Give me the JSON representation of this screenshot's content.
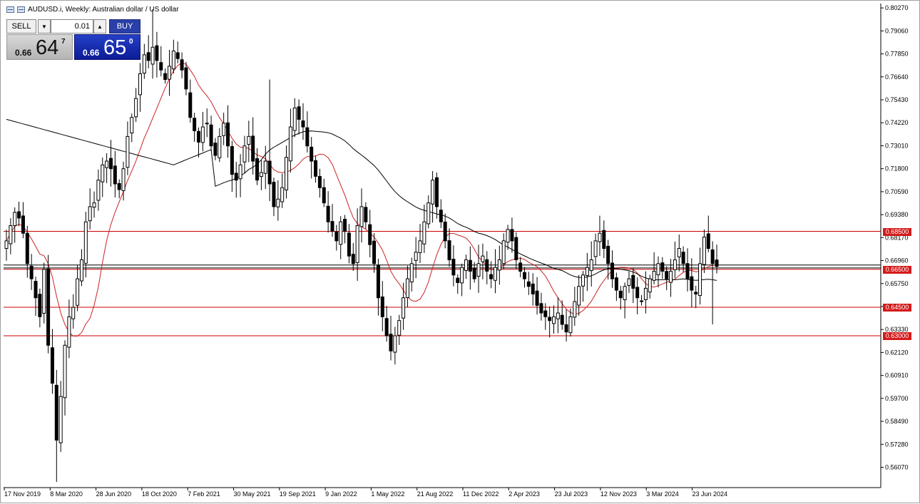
{
  "window": {
    "title": "AUDUSD.i, Weekly:  Australian dollar / US dollar"
  },
  "trade_panel": {
    "sell_label": "SELL",
    "buy_label": "BUY",
    "lot_value": "0.01",
    "sell_quote": {
      "prefix": "0.66",
      "big": "64",
      "sup": "7"
    },
    "buy_quote": {
      "prefix": "0.66",
      "big": "65",
      "sup": "0"
    }
  },
  "colors": {
    "candle": "#000000",
    "ma_fast": "#cc2222",
    "ma_slow": "#000000",
    "level_line": "#cc0000",
    "level_tag_bg": "#d51a1a",
    "axis_text": "#000000"
  },
  "chart_data": {
    "type": "candlestick",
    "symbol": "AUDUSD.i",
    "timeframe": "Weekly",
    "ylim": [
      0.55,
      0.805
    ],
    "y_ticks": [
      "0.80270",
      "0.79060",
      "0.77850",
      "0.76640",
      "0.75430",
      "0.74220",
      "0.73010",
      "0.71800",
      "0.70590",
      "0.69380",
      "0.68170",
      "0.66960",
      "0.65750",
      "0.64540",
      "0.63330",
      "0.62120",
      "0.60910",
      "0.59700",
      "0.58490",
      "0.57280",
      "0.56070"
    ],
    "x_ticks": [
      "17 Nov 2019",
      "8 Mar 2020",
      "28 Jun 2020",
      "18 Oct 2020",
      "7 Feb 2021",
      "30 May 2021",
      "19 Sep 2021",
      "9 Jan 2022",
      "1 May 2022",
      "21 Aug 2022",
      "11 Dec 2022",
      "2 Apr 2023",
      "23 Jul 2023",
      "12 Nov 2023",
      "3 Mar 2024",
      "23 Jun 2024"
    ],
    "horizontal_levels": [
      {
        "price": 0.685,
        "label": "0.68500"
      },
      {
        "price": 0.665,
        "label": "0.66500"
      },
      {
        "price": 0.645,
        "label": "0.64500"
      },
      {
        "price": 0.63,
        "label": "0.63000"
      }
    ],
    "current_bid": 0.66647,
    "current_ask": 0.6665,
    "close_path": [
      0.68,
      0.688,
      0.695,
      0.692,
      0.684,
      0.668,
      0.66,
      0.65,
      0.64,
      0.665,
      0.625,
      0.605,
      0.575,
      0.598,
      0.625,
      0.64,
      0.645,
      0.66,
      0.67,
      0.69,
      0.698,
      0.7,
      0.712,
      0.72,
      0.722,
      0.718,
      0.71,
      0.707,
      0.718,
      0.735,
      0.745,
      0.755,
      0.768,
      0.778,
      0.775,
      0.782,
      0.775,
      0.77,
      0.765,
      0.772,
      0.78,
      0.776,
      0.77,
      0.76,
      0.745,
      0.738,
      0.732,
      0.74,
      0.742,
      0.73,
      0.725,
      0.735,
      0.742,
      0.73,
      0.715,
      0.712,
      0.72,
      0.73,
      0.735,
      0.722,
      0.712,
      0.716,
      0.722,
      0.71,
      0.698,
      0.702,
      0.708,
      0.724,
      0.74,
      0.75,
      0.744,
      0.74,
      0.73,
      0.722,
      0.714,
      0.708,
      0.7,
      0.69,
      0.685,
      0.68,
      0.69,
      0.685,
      0.672,
      0.668,
      0.688,
      0.698,
      0.69,
      0.678,
      0.668,
      0.65,
      0.64,
      0.63,
      0.622,
      0.63,
      0.638,
      0.65,
      0.66,
      0.668,
      0.674,
      0.68,
      0.69,
      0.7,
      0.712,
      0.698,
      0.69,
      0.68,
      0.67,
      0.662,
      0.658,
      0.666,
      0.67,
      0.664,
      0.66,
      0.668,
      0.672,
      0.664,
      0.66,
      0.666,
      0.67,
      0.68,
      0.686,
      0.68,
      0.67,
      0.664,
      0.66,
      0.656,
      0.652,
      0.646,
      0.642,
      0.64,
      0.638,
      0.64,
      0.642,
      0.636,
      0.632,
      0.64,
      0.648,
      0.656,
      0.662,
      0.666,
      0.67,
      0.68,
      0.684,
      0.676,
      0.668,
      0.66,
      0.654,
      0.65,
      0.656,
      0.66,
      0.655,
      0.65,
      0.648,
      0.655,
      0.66,
      0.664,
      0.668,
      0.664,
      0.66,
      0.664,
      0.67,
      0.676,
      0.668,
      0.66,
      0.654,
      0.652,
      0.668,
      0.682,
      0.676,
      0.668,
      0.6665
    ]
  }
}
